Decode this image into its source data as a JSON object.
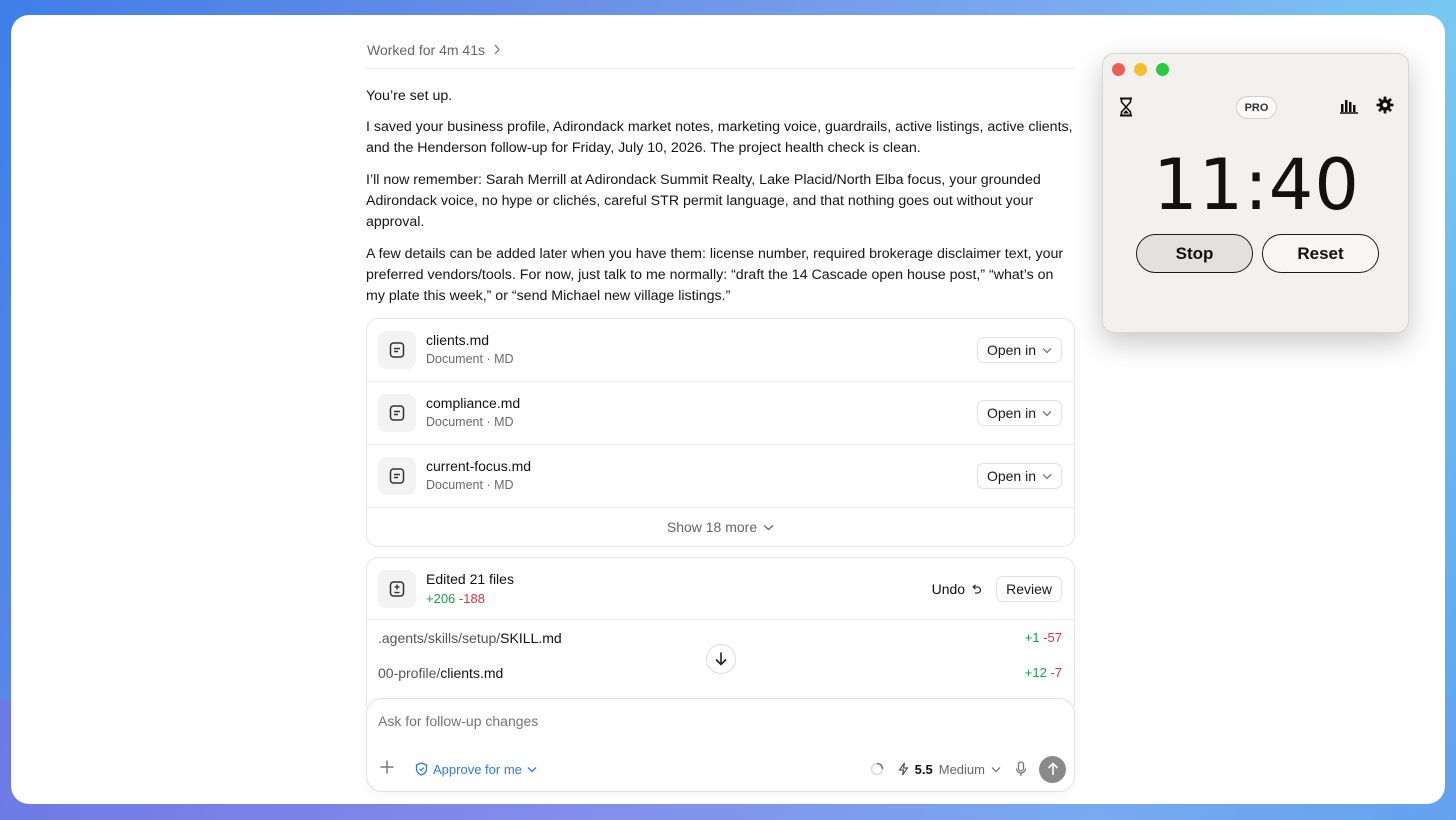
{
  "thread": {
    "worked_for": "Worked for 4m 41s",
    "messages": [
      "You’re set up.",
      "I saved your business profile, Adirondack market notes, marketing voice, guardrails, active listings, active clients, and the Henderson follow-up for Friday, July 10, 2026. The project health check is clean.",
      "I’ll now remember: Sarah Merrill at Adirondack Summit Realty, Lake Placid/North Elba focus, your grounded Adirondack voice, no hype or clichés, careful STR permit language, and that nothing goes out without your approval.",
      "A few details can be added later when you have them: license number, required brokerage disclaimer text, your preferred vendors/tools. For now, just talk to me normally: “draft the 14 Cascade open house post,” “what’s on my plate this week,” or “send Michael new village listings.”"
    ]
  },
  "files_card": {
    "items": [
      {
        "name": "clients.md",
        "type": "Document · MD",
        "open_label": "Open in"
      },
      {
        "name": "compliance.md",
        "type": "Document · MD",
        "open_label": "Open in"
      },
      {
        "name": "current-focus.md",
        "type": "Document · MD",
        "open_label": "Open in"
      }
    ],
    "show_more": "Show 18 more"
  },
  "edits_card": {
    "title": "Edited 21 files",
    "added": "+206",
    "removed": "-188",
    "undo_label": "Undo",
    "review_label": "Review",
    "changes": [
      {
        "dir": ".agents/skills/setup/",
        "file": "SKILL.md",
        "added": "+1",
        "removed": "-57"
      },
      {
        "dir": "00-profile/",
        "file": "clients.md",
        "added": "+12",
        "removed": "-7"
      }
    ]
  },
  "composer": {
    "placeholder": "Ask for follow-up changes",
    "approve_label": "Approve for me",
    "model_version": "5.5",
    "effort": "Medium"
  },
  "timer": {
    "badge": "PRO",
    "time": "11:40",
    "stop_label": "Stop",
    "reset_label": "Reset"
  }
}
